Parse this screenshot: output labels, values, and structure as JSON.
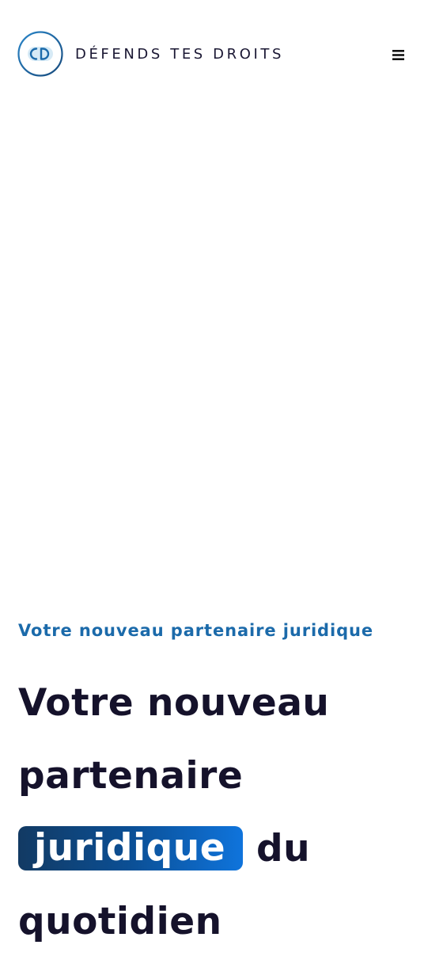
{
  "header": {
    "brand_name": "DÉFENDS TES DROITS",
    "logo_icon": "dtd-logo-icon",
    "menu_icon": "hamburger-menu-icon"
  },
  "hero": {
    "eyebrow": "Votre nouveau partenaire juridique",
    "title_line_1": "Votre nouveau",
    "title_line_2": "partenaire",
    "title_highlight": "juridique",
    "title_line_3_rest": "du",
    "title_line_4": "quotidien"
  },
  "colors": {
    "eyebrow": "#1b6aaa",
    "title": "#15122b",
    "highlight_start": "#123a63",
    "highlight_end": "#0f74dc",
    "logo_ring": "#1b6aaa"
  }
}
